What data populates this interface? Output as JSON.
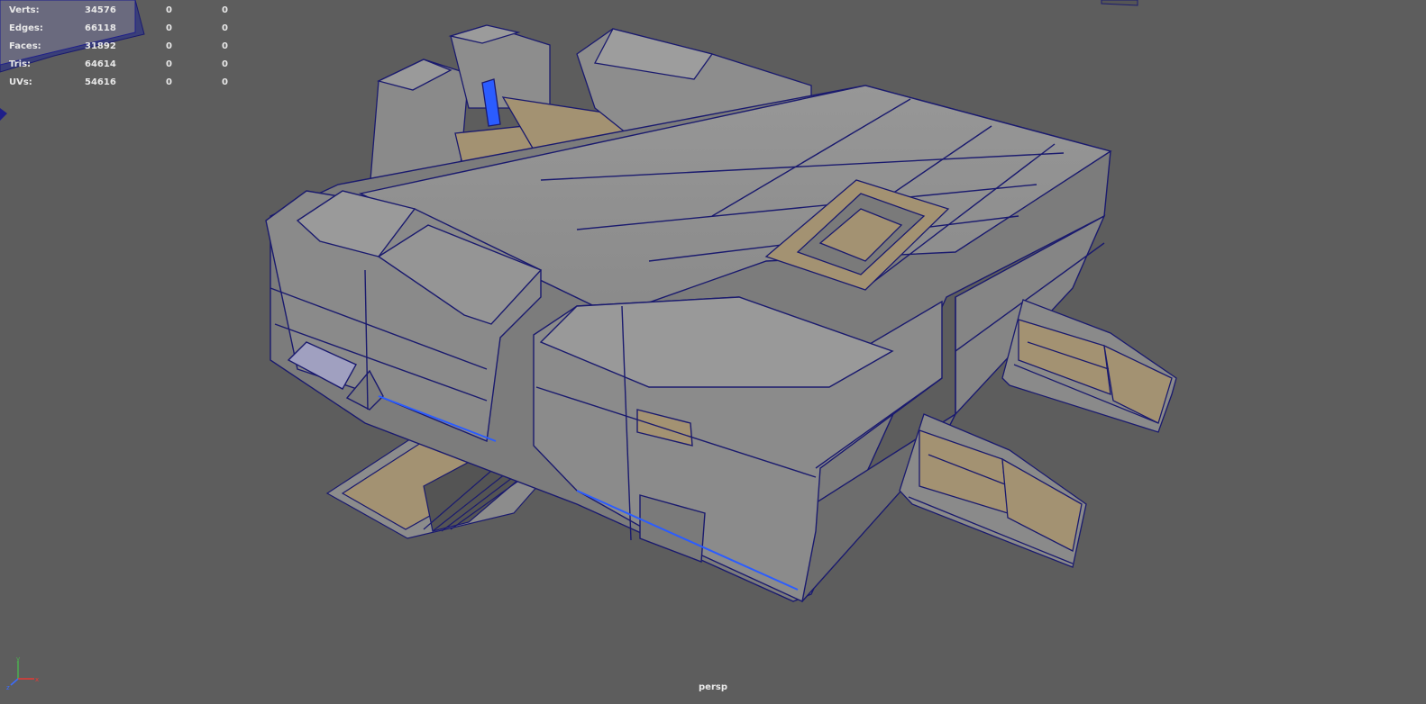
{
  "hud": {
    "rows": [
      {
        "label": "Verts:",
        "total": "34576",
        "selected": "0",
        "components": "0"
      },
      {
        "label": "Edges:",
        "total": "66118",
        "selected": "0",
        "components": "0"
      },
      {
        "label": "Faces:",
        "total": "31892",
        "selected": "0",
        "components": "0"
      },
      {
        "label": "Tris:",
        "total": "64614",
        "selected": "0",
        "components": "0"
      },
      {
        "label": "UVs:",
        "total": "54616",
        "selected": "0",
        "components": "0"
      }
    ]
  },
  "viewport": {
    "camera_label": "persp",
    "background_color": "#5d5d5d",
    "wireframe_color": "#1a1a6e",
    "surface_color": "#8f8f8f",
    "accent_face_color": "#9e8e70",
    "highlight_color": "#2b5cff"
  },
  "axis_gizmo": {
    "x": "x",
    "y": "y",
    "z": "z"
  }
}
